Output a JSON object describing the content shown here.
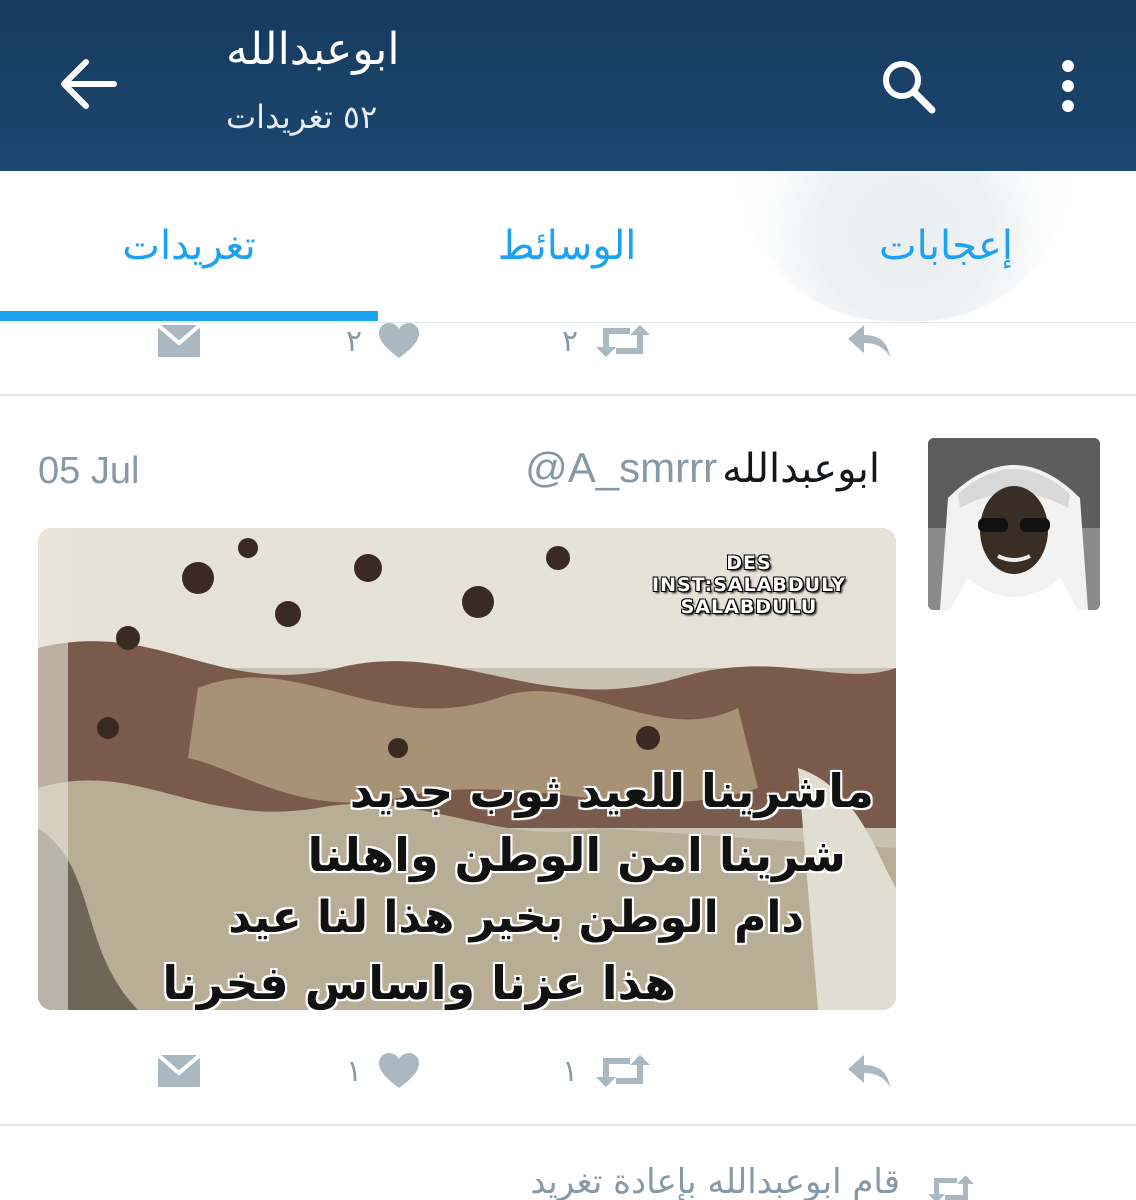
{
  "header": {
    "title": "ابوعبدالله",
    "subtitle": "٥٢ تغريدات"
  },
  "tabs": [
    {
      "label": "تغريدات",
      "selected": true
    },
    {
      "label": "الوسائط",
      "selected": false
    },
    {
      "label": "إعجابات",
      "selected": false
    }
  ],
  "previous_tweet_actions": {
    "retweets": "٢",
    "likes": "٢"
  },
  "tweet": {
    "date": "05 Jul",
    "handle": "@A_smrrr",
    "name": "ابوعبدالله",
    "image_text": {
      "watermark": [
        "DES",
        "INST:SALABDULY",
        "SALABDULU"
      ],
      "lines": [
        "ماشرينا للعيد ثوب جديد",
        "شرينا امن الوطن واهلنا",
        "دام الوطن بخير هذا لنا عيد",
        "هذا عزنا واساس فخرنا"
      ]
    },
    "retweets": "١",
    "likes": "١"
  },
  "retweet_note": "قام ابوعبدالله بإعادة تغريد",
  "colors": {
    "header_bg": "#1c4770",
    "accent": "#1da1f2",
    "muted": "#8899a6"
  }
}
